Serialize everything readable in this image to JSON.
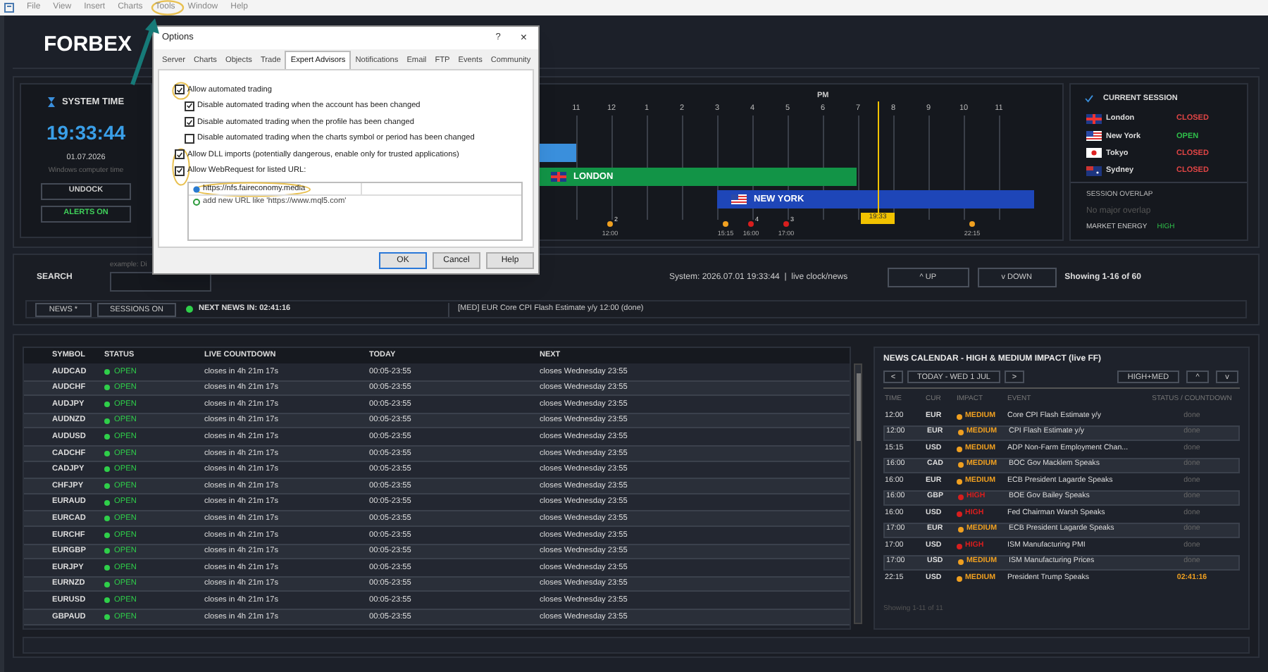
{
  "menu": [
    "File",
    "View",
    "Insert",
    "Charts",
    "Tools",
    "Window",
    "Help"
  ],
  "brand": "FORBEX",
  "system_time": {
    "title": "SYSTEM TIME",
    "time": "19:33:44",
    "date": "01.07.2026",
    "caption": "Windows computer time",
    "buttons": [
      {
        "label": "UNDOCK",
        "active": false
      },
      {
        "label": "ALERTS ON",
        "active": true
      }
    ]
  },
  "timeline": {
    "period": "PM",
    "hours": [
      "11",
      "12",
      "1",
      "2",
      "3",
      "4",
      "5",
      "6",
      "7",
      "8",
      "9",
      "10",
      "11"
    ],
    "sessions": [
      {
        "color": "#3a8fdc"
      },
      {
        "label": "LONDON",
        "color": "#129447"
      },
      {
        "label": "NEW YORK",
        "color": "#1e46b8"
      }
    ],
    "now": "19:33",
    "events": [
      {
        "time": "12:00",
        "color": "#f0a020",
        "count": "2"
      },
      {
        "time": "15:15",
        "color": "#f0a020"
      },
      {
        "time": "16:00",
        "color": "#d81e1e",
        "count": "4"
      },
      {
        "time": "17:00",
        "color": "#d81e1e",
        "count": "3"
      },
      {
        "time": "22:15",
        "color": "#f0a020"
      }
    ]
  },
  "current_session": {
    "title": "CURRENT SESSION",
    "sessions": [
      {
        "name": "London",
        "status": "CLOSED",
        "open": false
      },
      {
        "name": "New York",
        "status": "OPEN",
        "open": true
      },
      {
        "name": "Tokyo",
        "status": "CLOSED",
        "open": false
      },
      {
        "name": "Sydney",
        "status": "CLOSED",
        "open": false
      }
    ],
    "overlap_label": "SESSION OVERLAP",
    "overlap_value": "No major overlap",
    "energy_label": "MARKET ENERGY",
    "energy_value": "HIGH"
  },
  "search": {
    "label": "SEARCH",
    "hint": "example: Di",
    "system": "System: 2026.07.01 19:33:44  |  live clock/news",
    "buttons": [
      "^ UP",
      "v DOWN"
    ],
    "showing": "Showing 1-16 of 60"
  },
  "news_bar": {
    "buttons": [
      "NEWS *",
      "SESSIONS ON"
    ],
    "next": "NEXT NEWS IN: 02:41:16",
    "ticker": "[MED] EUR Core CPI Flash Estimate y/y 12:00 (done)"
  },
  "table": {
    "columns": [
      "SYMBOL",
      "STATUS",
      "LIVE COUNTDOWN",
      "TODAY",
      "NEXT"
    ],
    "rows": [
      {
        "symbol": "AUDCAD",
        "status": "OPEN",
        "open": true,
        "countdown": "closes in 4h 21m 17s",
        "today": "00:05-23:55",
        "next": "closes Wednesday 23:55"
      },
      {
        "symbol": "AUDCHF",
        "status": "OPEN",
        "open": true,
        "countdown": "closes in 4h 21m 17s",
        "today": "00:05-23:55",
        "next": "closes Wednesday 23:55"
      },
      {
        "symbol": "AUDJPY",
        "status": "OPEN",
        "open": true,
        "countdown": "closes in 4h 21m 17s",
        "today": "00:05-23:55",
        "next": "closes Wednesday 23:55"
      },
      {
        "symbol": "AUDNZD",
        "status": "OPEN",
        "open": true,
        "countdown": "closes in 4h 21m 17s",
        "today": "00:05-23:55",
        "next": "closes Wednesday 23:55"
      },
      {
        "symbol": "AUDUSD",
        "status": "OPEN",
        "open": true,
        "countdown": "closes in 4h 21m 17s",
        "today": "00:05-23:55",
        "next": "closes Wednesday 23:55"
      },
      {
        "symbol": "CADCHF",
        "status": "OPEN",
        "open": true,
        "countdown": "closes in 4h 21m 17s",
        "today": "00:05-23:55",
        "next": "closes Wednesday 23:55"
      },
      {
        "symbol": "CADJPY",
        "status": "OPEN",
        "open": true,
        "countdown": "closes in 4h 21m 17s",
        "today": "00:05-23:55",
        "next": "closes Wednesday 23:55"
      },
      {
        "symbol": "CHFJPY",
        "status": "OPEN",
        "open": true,
        "countdown": "closes in 4h 21m 17s",
        "today": "00:05-23:55",
        "next": "closes Wednesday 23:55"
      },
      {
        "symbol": "EURAUD",
        "status": "OPEN",
        "open": true,
        "countdown": "closes in 4h 21m 17s",
        "today": "00:05-23:55",
        "next": "closes Wednesday 23:55"
      },
      {
        "symbol": "EURCAD",
        "status": "OPEN",
        "open": true,
        "countdown": "closes in 4h 21m 17s",
        "today": "00:05-23:55",
        "next": "closes Wednesday 23:55"
      },
      {
        "symbol": "EURCHF",
        "status": "OPEN",
        "open": true,
        "countdown": "closes in 4h 21m 17s",
        "today": "00:05-23:55",
        "next": "closes Wednesday 23:55"
      },
      {
        "symbol": "EURGBP",
        "status": "OPEN",
        "open": true,
        "countdown": "closes in 4h 21m 17s",
        "today": "00:05-23:55",
        "next": "closes Wednesday 23:55"
      },
      {
        "symbol": "EURJPY",
        "status": "OPEN",
        "open": true,
        "countdown": "closes in 4h 21m 17s",
        "today": "00:05-23:55",
        "next": "closes Wednesday 23:55"
      },
      {
        "symbol": "EURNZD",
        "status": "OPEN",
        "open": true,
        "countdown": "closes in 4h 21m 17s",
        "today": "00:05-23:55",
        "next": "closes Wednesday 23:55"
      },
      {
        "symbol": "EURUSD",
        "status": "OPEN",
        "open": true,
        "countdown": "closes in 4h 21m 17s",
        "today": "00:05-23:55",
        "next": "closes Wednesday 23:55"
      },
      {
        "symbol": "GBPAUD",
        "status": "OPEN",
        "open": true,
        "countdown": "closes in 4h 21m 17s",
        "today": "00:05-23:55",
        "next": "closes Wednesday 23:55"
      }
    ]
  },
  "calendar": {
    "title": "NEWS CALENDAR - HIGH & MEDIUM IMPACT (live FF)",
    "nav": [
      "<",
      "TODAY - WED 1 JUL",
      ">"
    ],
    "filters": [
      "HIGH+MED",
      "^",
      "v"
    ],
    "columns": [
      "TIME",
      "CUR",
      "IMPACT",
      "EVENT",
      "STATUS / COUNTDOWN"
    ],
    "rows": [
      {
        "time": "12:00",
        "currency": "EUR",
        "impact": "MEDIUM",
        "color": "#f0a020",
        "event": "Core CPI Flash Estimate y/y",
        "status": "done",
        "done": true
      },
      {
        "time": "12:00",
        "currency": "EUR",
        "impact": "MEDIUM",
        "color": "#f0a020",
        "event": "CPI Flash Estimate y/y",
        "status": "done",
        "done": true
      },
      {
        "time": "15:15",
        "currency": "USD",
        "impact": "MEDIUM",
        "color": "#f0a020",
        "event": "ADP Non-Farm Employment Chan...",
        "status": "done",
        "done": true
      },
      {
        "time": "16:00",
        "currency": "CAD",
        "impact": "MEDIUM",
        "color": "#f0a020",
        "event": "BOC Gov Macklem Speaks",
        "status": "done",
        "done": true
      },
      {
        "time": "16:00",
        "currency": "EUR",
        "impact": "MEDIUM",
        "color": "#f0a020",
        "event": "ECB President Lagarde Speaks",
        "status": "done",
        "done": true
      },
      {
        "time": "16:00",
        "currency": "GBP",
        "impact": "HIGH",
        "color": "#d81e1e",
        "event": "BOE Gov Bailey Speaks",
        "status": "done",
        "done": true
      },
      {
        "time": "16:00",
        "currency": "USD",
        "impact": "HIGH",
        "color": "#d81e1e",
        "event": "Fed Chairman Warsh Speaks",
        "status": "done",
        "done": true
      },
      {
        "time": "17:00",
        "currency": "EUR",
        "impact": "MEDIUM",
        "color": "#f0a020",
        "event": "ECB President Lagarde Speaks",
        "status": "done",
        "done": true
      },
      {
        "time": "17:00",
        "currency": "USD",
        "impact": "HIGH",
        "color": "#d81e1e",
        "event": "ISM Manufacturing PMI",
        "status": "done",
        "done": true
      },
      {
        "time": "17:00",
        "currency": "USD",
        "impact": "MEDIUM",
        "color": "#f0a020",
        "event": "ISM Manufacturing Prices",
        "status": "done",
        "done": true
      },
      {
        "time": "22:15",
        "currency": "USD",
        "impact": "MEDIUM",
        "color": "#f0a020",
        "event": "President Trump Speaks",
        "status": "02:41:16",
        "done": false
      }
    ],
    "showing": "Showing 1-11 of 11"
  },
  "dialog": {
    "title": "Options",
    "help": "?",
    "close": "×",
    "tabs": [
      {
        "label": "Server",
        "selected": false
      },
      {
        "label": "Charts",
        "selected": false
      },
      {
        "label": "Objects",
        "selected": false
      },
      {
        "label": "Trade",
        "selected": false
      },
      {
        "label": "Expert Advisors",
        "selected": true
      },
      {
        "label": "Notifications",
        "selected": false
      },
      {
        "label": "Email",
        "selected": false
      },
      {
        "label": "FTP",
        "selected": false
      },
      {
        "label": "Events",
        "selected": false
      },
      {
        "label": "Community",
        "selected": false
      }
    ],
    "options": [
      {
        "label": "Allow automated trading",
        "checked": true,
        "children": [
          {
            "label": "Disable automated trading when the account has been changed",
            "checked": true
          },
          {
            "label": "Disable automated trading when the profile has been changed",
            "checked": true
          },
          {
            "label": "Disable automated trading when the charts symbol or period has been changed",
            "checked": false
          }
        ]
      },
      {
        "label": "Allow DLL imports (potentially dangerous, enable only for trusted applications)",
        "checked": true
      },
      {
        "label": "Allow WebRequest for listed URL:",
        "checked": true
      }
    ],
    "urls": [
      {
        "kind": "url",
        "text": "https://nfs.faireconomy.media"
      },
      {
        "kind": "add",
        "text": "add new URL like 'https://www.mql5.com'"
      }
    ],
    "buttons": [
      {
        "label": "OK",
        "default": true
      },
      {
        "label": "Cancel",
        "default": false
      },
      {
        "label": "Help",
        "default": false
      }
    ]
  }
}
